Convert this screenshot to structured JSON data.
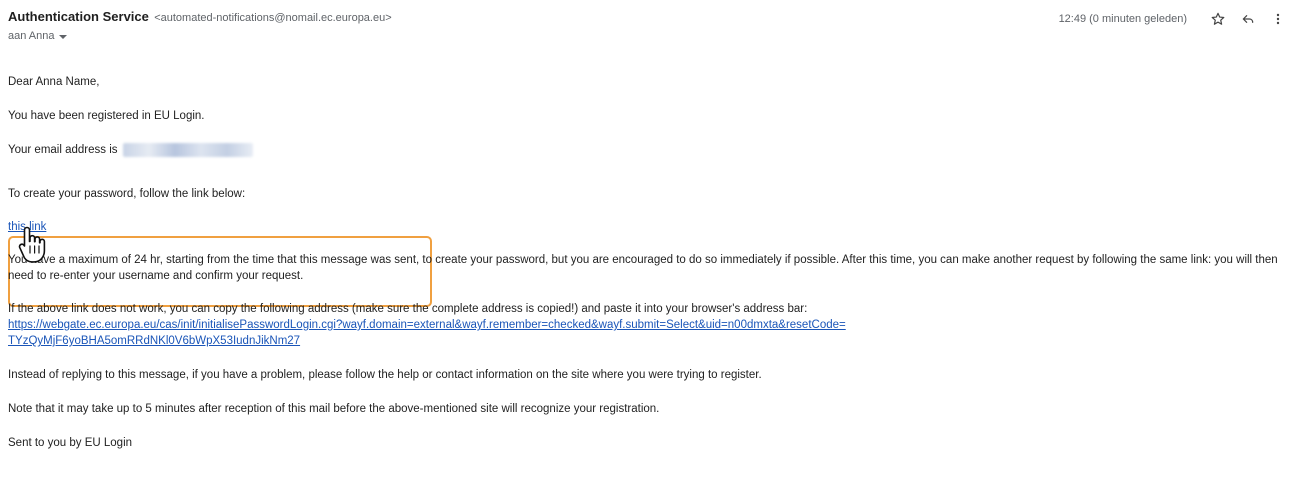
{
  "header": {
    "sender_name": "Authentication Service",
    "sender_email": "<automated-notifications@nomail.ec.europa.eu>",
    "recipient": "aan Anna",
    "timestamp": "12:49 (0 minuten geleden)",
    "icons": [
      "star-icon",
      "reply-icon",
      "more-vert-icon"
    ]
  },
  "body": {
    "greeting": "Dear Anna Name,",
    "registered": "You have been registered in EU Login.",
    "email_prefix": "Your email address is",
    "email_blurred": "expertuser+two+DE07@gmail.com",
    "create_password": "To create your password, follow the link below:",
    "link_label": "this link",
    "max_time": "You have a maximum of 24 hr, starting from the time that this message was sent, to create your password, but you are encouraged to do so immediately if possible. After this time, you can make another request by following the same link: you will then need to re-enter your username and confirm your request.",
    "copy_address": "If the above link does not work, you can copy the following address (make sure the complete address is copied!) and paste it into your browser's address bar:",
    "url_line1": "https://webgate.ec.europa.eu/cas/init/initialisePasswordLogin.cgi?wayf.domain=external&wayf.remember=checked&wayf.submit=Select&uid=n00dmxta&resetCode=",
    "url_line2": "TYzQyMjF6yoBHA5omRRdNKl0V6bWpX53IudnJikNm27",
    "instead_reply": "Instead of replying to this message, if you have a problem, please follow the help or contact information on the site where you were trying to register.",
    "note": "Note that it may take up to 5 minutes after reception of this mail before the above-mentioned site will recognize your registration.",
    "sent_by": "Sent to you by EU Login"
  },
  "colors": {
    "link": "#1a55b8",
    "highlight": "#f0a040",
    "muted": "#5f6368"
  }
}
